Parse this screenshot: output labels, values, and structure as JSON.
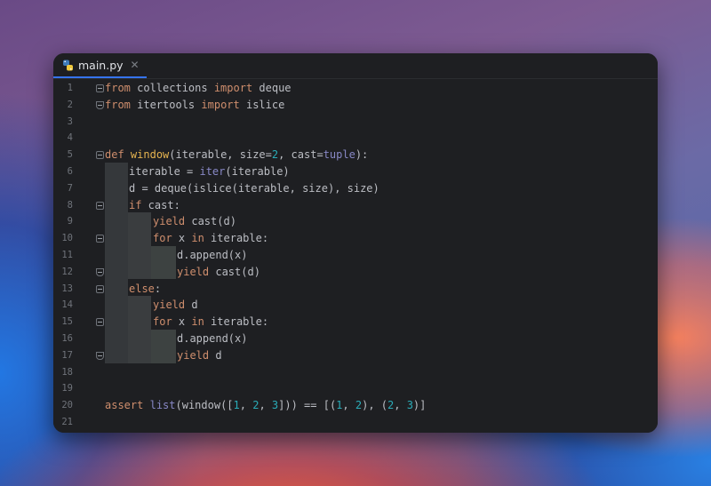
{
  "tab": {
    "filename": "main.py",
    "close_glyph": "✕",
    "icon": "python-file-icon"
  },
  "lines": [
    {
      "n": "1"
    },
    {
      "n": "2"
    },
    {
      "n": "3"
    },
    {
      "n": "4"
    },
    {
      "n": "5"
    },
    {
      "n": "6"
    },
    {
      "n": "7"
    },
    {
      "n": "8"
    },
    {
      "n": "9"
    },
    {
      "n": "10"
    },
    {
      "n": "11"
    },
    {
      "n": "12"
    },
    {
      "n": "13"
    },
    {
      "n": "14"
    },
    {
      "n": "15"
    },
    {
      "n": "16"
    },
    {
      "n": "17"
    },
    {
      "n": "18"
    },
    {
      "n": "19"
    },
    {
      "n": "20"
    },
    {
      "n": "21"
    }
  ],
  "code": {
    "l1": [
      "from",
      " collections ",
      "import",
      " deque"
    ],
    "l2": [
      "from",
      " itertools ",
      "import",
      " islice"
    ],
    "l5": [
      "def",
      " ",
      "window",
      "(iterable, size=",
      "2",
      ", cast=",
      "tuple",
      "):"
    ],
    "l6": [
      "iterable = ",
      "iter",
      "(iterable)"
    ],
    "l7": [
      "d = deque(islice(iterable, size), size)"
    ],
    "l8": [
      "if",
      " cast:"
    ],
    "l9": [
      "yield",
      " cast(d)"
    ],
    "l10": [
      "for",
      " x ",
      "in",
      " iterable:"
    ],
    "l11": [
      "d.append(x)"
    ],
    "l12": [
      "yield",
      " cast(d)"
    ],
    "l13": [
      "else",
      ":"
    ],
    "l14": [
      "yield",
      " d"
    ],
    "l15": [
      "for",
      " x ",
      "in",
      " iterable:"
    ],
    "l16": [
      "d.append(x)"
    ],
    "l17": [
      "yield",
      " d"
    ],
    "l20": [
      "assert",
      " ",
      "list",
      "(window([",
      "1",
      ", ",
      "2",
      ", ",
      "3",
      "])) == [(",
      "1",
      ", ",
      "2",
      "), (",
      "2",
      ", ",
      "3",
      ")]"
    ]
  }
}
